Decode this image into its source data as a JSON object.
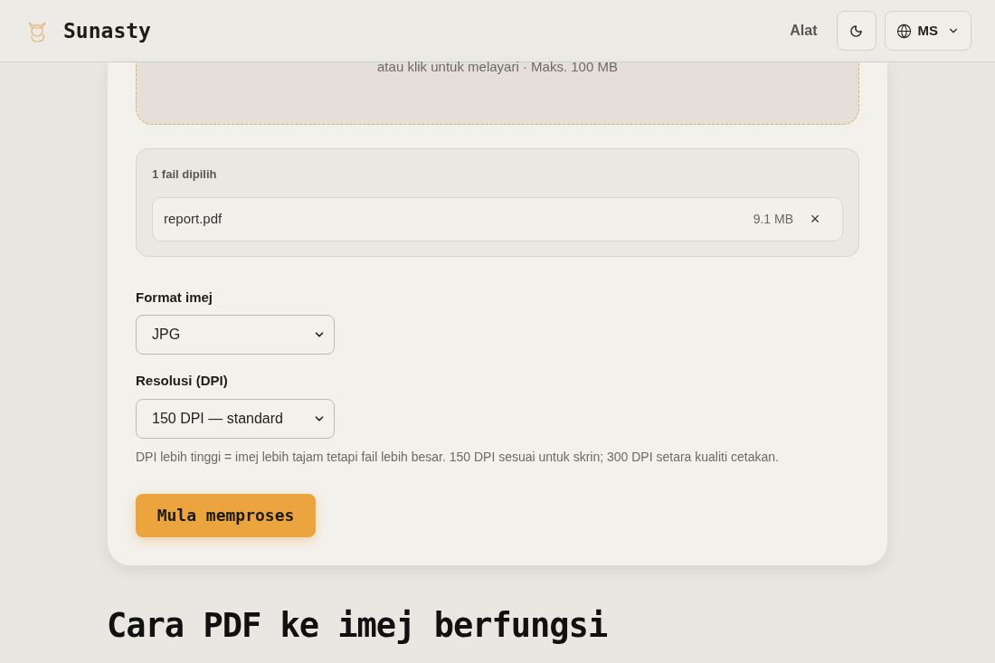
{
  "header": {
    "brand": "Sunasty",
    "nav_link": "Alat",
    "language": "MS"
  },
  "dropzone": {
    "hint": "atau klik untuk melayari · Maks. 100 MB"
  },
  "files": {
    "heading": "1 fail dipilih",
    "items": [
      {
        "name": "report.pdf",
        "size": "9.1 MB",
        "remove": "×"
      }
    ]
  },
  "fields": [
    {
      "label": "Format imej",
      "value": "JPG"
    },
    {
      "label": "Resolusi (DPI)",
      "value": "150 DPI — standard"
    }
  ],
  "help": "DPI lebih tinggi = imej lebih tajam tetapi fail lebih besar. 150 DPI sesuai untuk skrin; 300 DPI setara kualiti cetakan.",
  "submit": "Mula memproses",
  "section_title": "Cara PDF ke imej berfungsi"
}
